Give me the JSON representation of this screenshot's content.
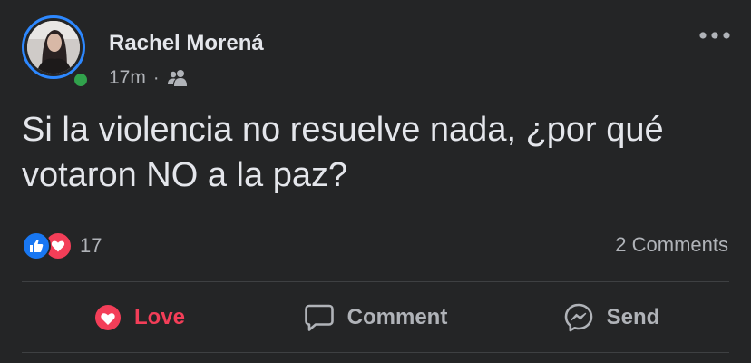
{
  "post": {
    "author_name": "Rachel Morená",
    "timestamp": "17m",
    "meta_separator": "·",
    "audience_icon": "friends-icon",
    "text": "Si la violencia no resuelve nada, ¿por qué votaron NO a la paz?",
    "reactions": {
      "icons": [
        "like-reaction-icon",
        "love-reaction-icon"
      ],
      "count": "17"
    },
    "comments_label": "2 Comments",
    "actions": {
      "love_label": "Love",
      "comment_label": "Comment",
      "send_label": "Send"
    }
  },
  "colors": {
    "background": "#242526",
    "text_primary": "#e4e6eb",
    "text_secondary": "#b0b3b8",
    "online": "#31a24c",
    "avatar_ring": "#2d88ff",
    "love": "#f33e58",
    "like": "#1877f2"
  }
}
